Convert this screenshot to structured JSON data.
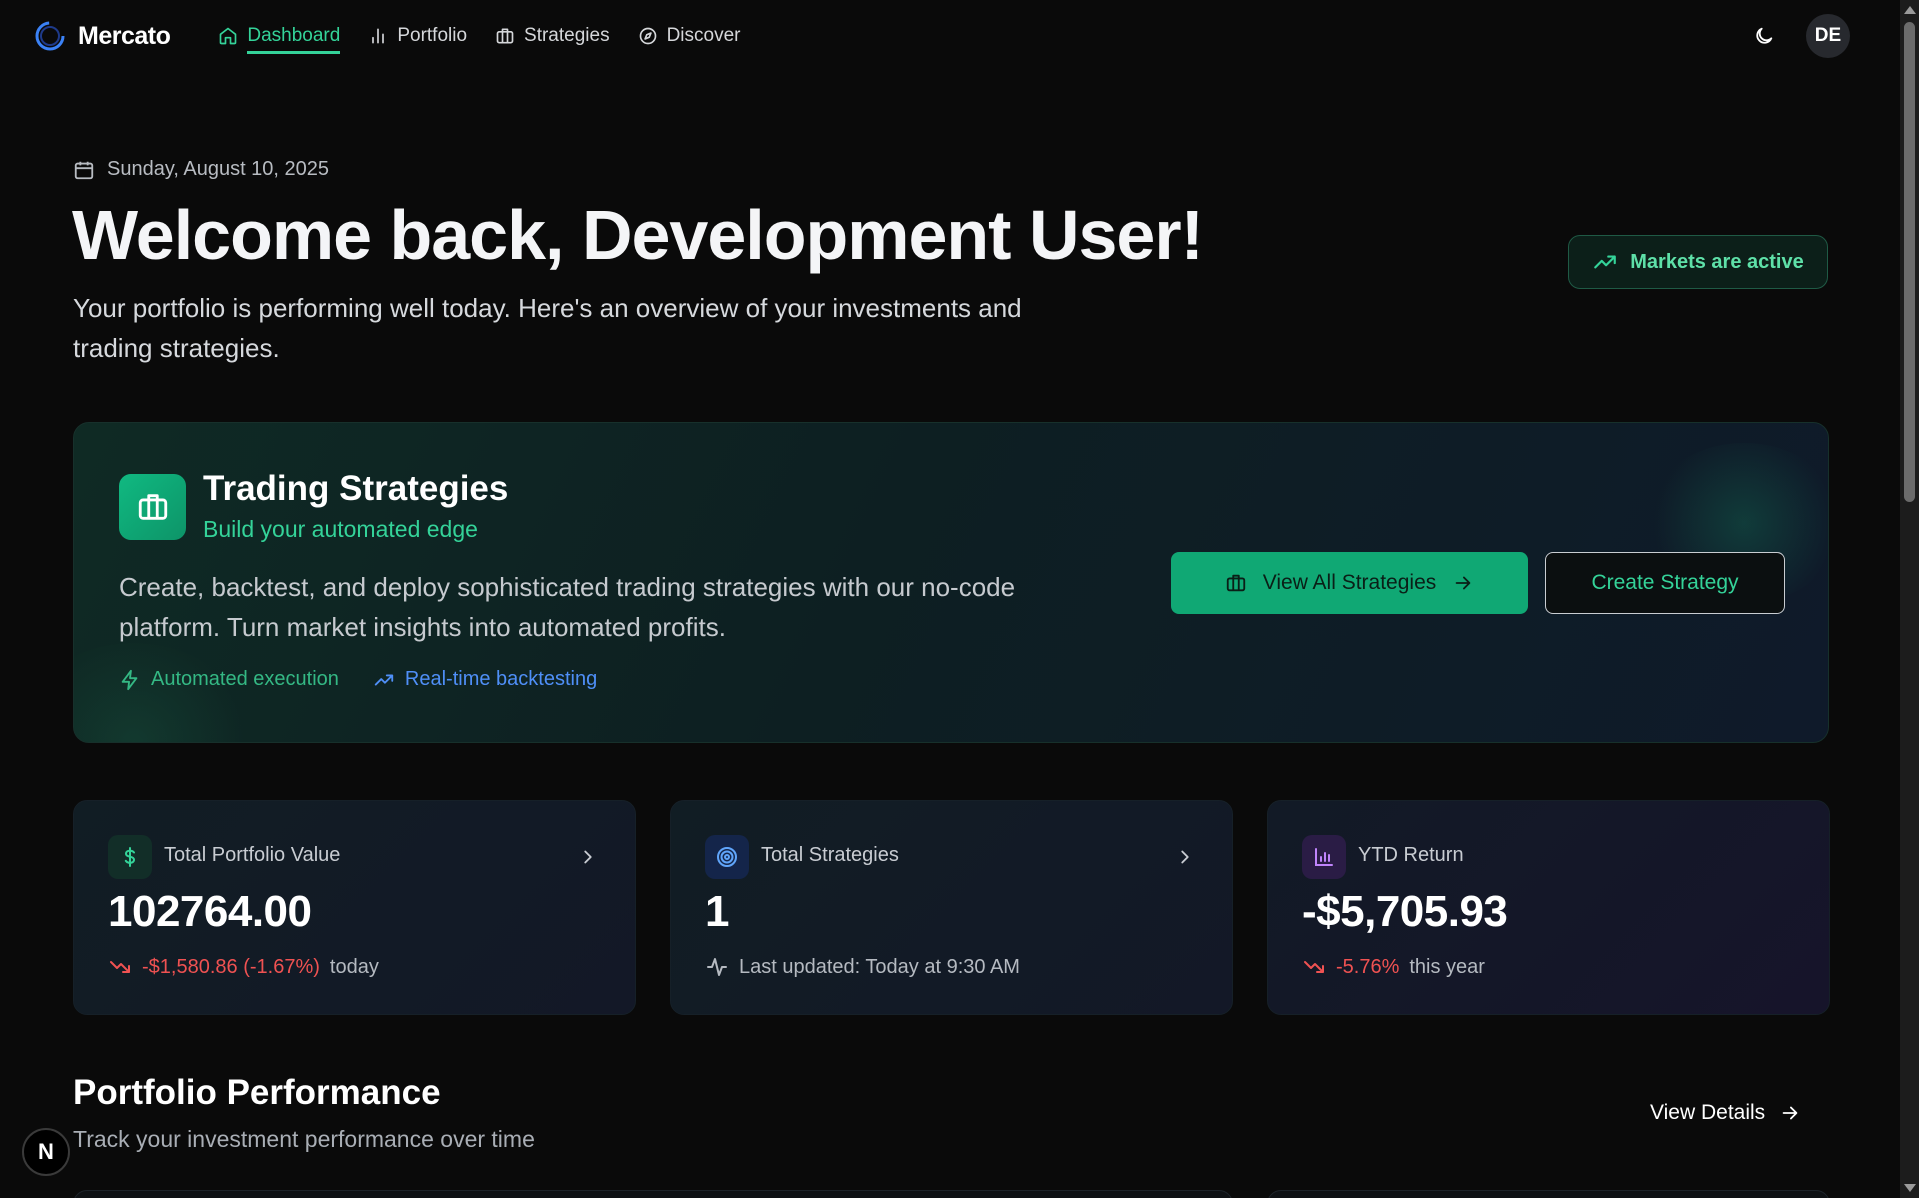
{
  "app": {
    "name": "Mercato",
    "logo_icon": "ring-logo-icon"
  },
  "nav": {
    "items": [
      {
        "label": "Dashboard",
        "icon": "home-icon",
        "active": true
      },
      {
        "label": "Portfolio",
        "icon": "bar-chart-icon",
        "active": false
      },
      {
        "label": "Strategies",
        "icon": "briefcase-icon",
        "active": false
      },
      {
        "label": "Discover",
        "icon": "compass-icon",
        "active": false
      }
    ]
  },
  "user": {
    "initials": "DE",
    "theme_icon": "moon-icon"
  },
  "header": {
    "date": "Sunday, August 10, 2025",
    "welcome": "Welcome back, Development User!",
    "intro": "Your portfolio is performing well today. Here's an overview of your investments and trading strategies.",
    "market_status": "Markets are active"
  },
  "banner": {
    "title": "Trading Strategies",
    "subtitle": "Build your automated edge",
    "description": "Create, backtest, and deploy sophisticated trading strategies with our no-code platform. Turn market insights into automated profits.",
    "features": [
      "Automated execution",
      "Real-time backtesting"
    ],
    "primary_button": "View All Strategies",
    "secondary_button": "Create Strategy"
  },
  "cards": {
    "portfolio": {
      "label": "Total Portfolio Value",
      "value": "102764.00",
      "change": "-$1,580.86 (-1.67%)",
      "suffix": "today"
    },
    "strategies": {
      "label": "Total Strategies",
      "value": "1",
      "note": "Last updated: Today at 9:30 AM"
    },
    "ytd": {
      "label": "YTD Return",
      "value": "-$5,705.93",
      "change": "-5.76%",
      "suffix": "this year"
    }
  },
  "performance": {
    "title": "Portfolio Performance",
    "subtitle": "Track your investment performance over time",
    "link": "View Details"
  },
  "badge": {
    "label": "N"
  },
  "colors": {
    "accent": "#34d399",
    "negative": "#f05252",
    "primary_button": "#10a874",
    "link_blue": "#4f8ff7",
    "background": "#0a0a0a"
  }
}
